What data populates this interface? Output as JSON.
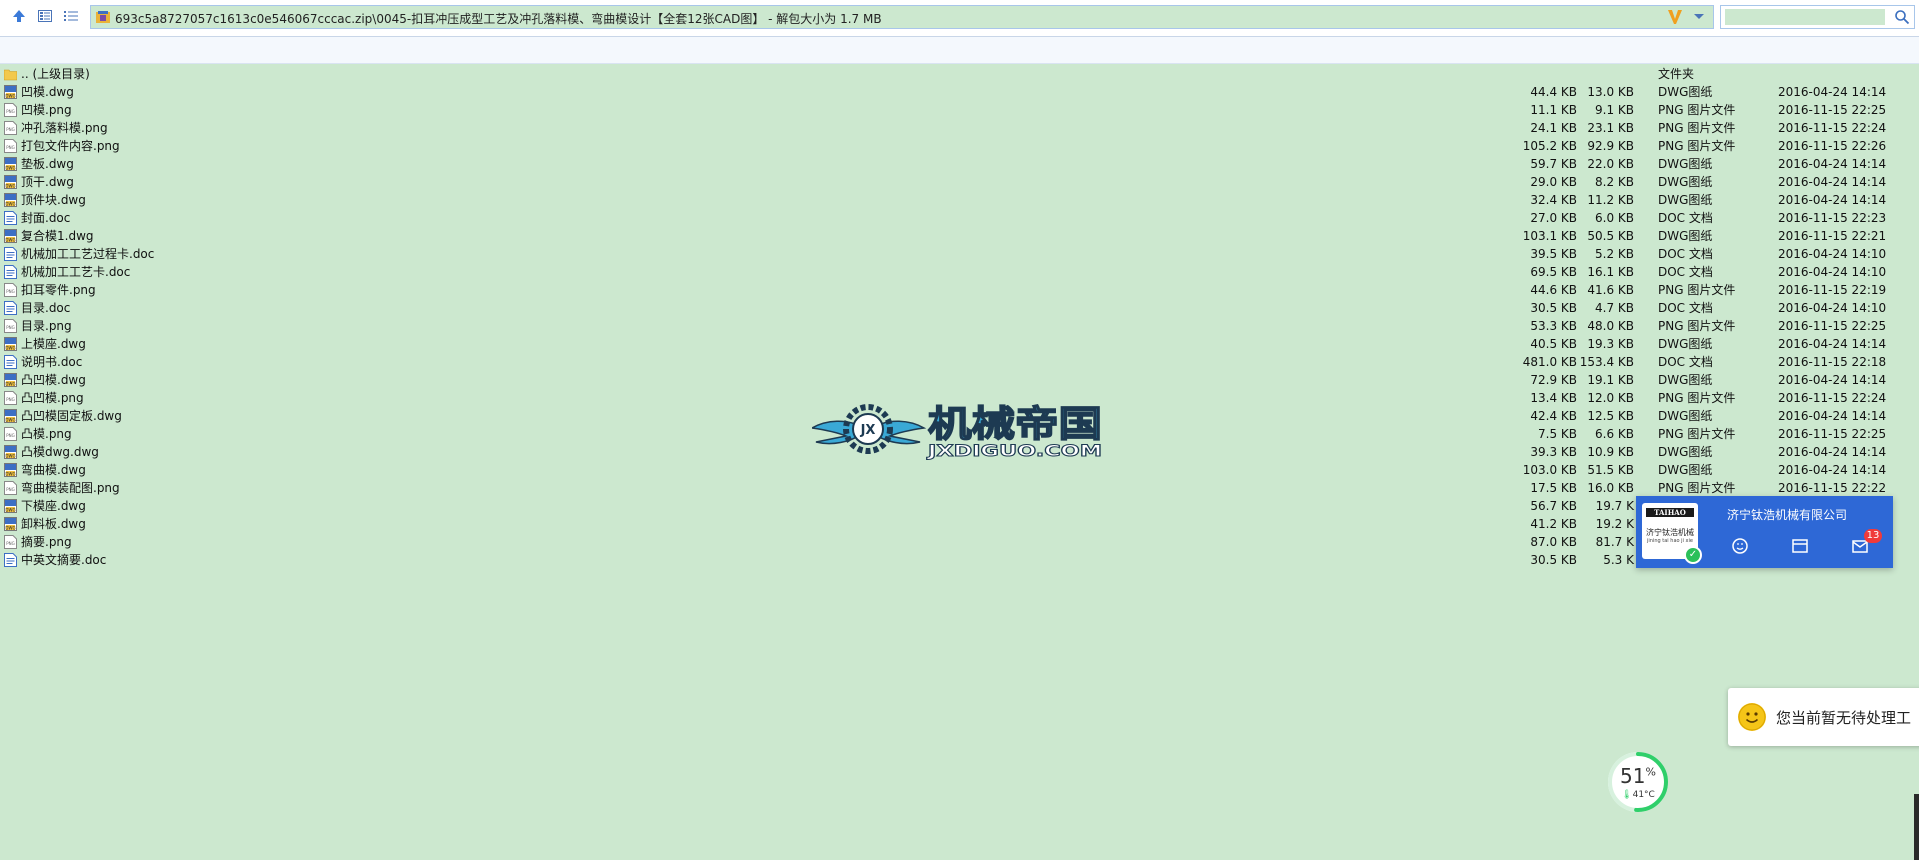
{
  "toolbar": {
    "address_text": "693c5a8727057c1613c0e546067cccac.zip\\0045-扣耳冲压成型工艺及冲孔落料模、弯曲模设计【全套12张CAD图】 - 解包大小为 1.7 MB",
    "search_placeholder": ""
  },
  "files": [
    {
      "name": ".. (上级目录)",
      "size": "",
      "packed": "",
      "type": "文件夹",
      "date": "",
      "icon": "folder-icon"
    },
    {
      "name": "凹模.dwg",
      "size": "44.4 KB",
      "packed": "13.0 KB",
      "type": "DWG图纸",
      "date": "2016-04-24 14:14",
      "icon": "dwg-file-icon"
    },
    {
      "name": "凹模.png",
      "size": "11.1 KB",
      "packed": "9.1 KB",
      "type": "PNG 图片文件",
      "date": "2016-11-15 22:25",
      "icon": "png-file-icon"
    },
    {
      "name": "冲孔落料模.png",
      "size": "24.1 KB",
      "packed": "23.1 KB",
      "type": "PNG 图片文件",
      "date": "2016-11-15 22:24",
      "icon": "png-file-icon"
    },
    {
      "name": "打包文件内容.png",
      "size": "105.2 KB",
      "packed": "92.9 KB",
      "type": "PNG 图片文件",
      "date": "2016-11-15 22:26",
      "icon": "png-file-icon"
    },
    {
      "name": "垫板.dwg",
      "size": "59.7 KB",
      "packed": "22.0 KB",
      "type": "DWG图纸",
      "date": "2016-04-24 14:14",
      "icon": "dwg-file-icon"
    },
    {
      "name": "顶干.dwg",
      "size": "29.0 KB",
      "packed": "8.2 KB",
      "type": "DWG图纸",
      "date": "2016-04-24 14:14",
      "icon": "dwg-file-icon"
    },
    {
      "name": "顶件块.dwg",
      "size": "32.4 KB",
      "packed": "11.2 KB",
      "type": "DWG图纸",
      "date": "2016-04-24 14:14",
      "icon": "dwg-file-icon"
    },
    {
      "name": "封面.doc",
      "size": "27.0 KB",
      "packed": "6.0 KB",
      "type": "DOC 文档",
      "date": "2016-11-15 22:23",
      "icon": "doc-file-icon"
    },
    {
      "name": "复合模1.dwg",
      "size": "103.1 KB",
      "packed": "50.5 KB",
      "type": "DWG图纸",
      "date": "2016-11-15 22:21",
      "icon": "dwg-file-icon"
    },
    {
      "name": "机械加工工艺过程卡.doc",
      "size": "39.5 KB",
      "packed": "5.2 KB",
      "type": "DOC 文档",
      "date": "2016-04-24 14:10",
      "icon": "doc-file-icon"
    },
    {
      "name": "机械加工工艺卡.doc",
      "size": "69.5 KB",
      "packed": "16.1 KB",
      "type": "DOC 文档",
      "date": "2016-04-24 14:10",
      "icon": "doc-file-icon"
    },
    {
      "name": "扣耳零件.png",
      "size": "44.6 KB",
      "packed": "41.6 KB",
      "type": "PNG 图片文件",
      "date": "2016-11-15 22:19",
      "icon": "png-file-icon"
    },
    {
      "name": "目录.doc",
      "size": "30.5 KB",
      "packed": "4.7 KB",
      "type": "DOC 文档",
      "date": "2016-04-24 14:10",
      "icon": "doc-file-icon"
    },
    {
      "name": "目录.png",
      "size": "53.3 KB",
      "packed": "48.0 KB",
      "type": "PNG 图片文件",
      "date": "2016-11-15 22:25",
      "icon": "png-file-icon"
    },
    {
      "name": "上模座.dwg",
      "size": "40.5 KB",
      "packed": "19.3 KB",
      "type": "DWG图纸",
      "date": "2016-04-24 14:14",
      "icon": "dwg-file-icon"
    },
    {
      "name": "说明书.doc",
      "size": "481.0 KB",
      "packed": "153.4 KB",
      "type": "DOC 文档",
      "date": "2016-11-15 22:18",
      "icon": "doc-file-icon"
    },
    {
      "name": "凸凹模.dwg",
      "size": "72.9 KB",
      "packed": "19.1 KB",
      "type": "DWG图纸",
      "date": "2016-04-24 14:14",
      "icon": "dwg-file-icon"
    },
    {
      "name": "凸凹模.png",
      "size": "13.4 KB",
      "packed": "12.0 KB",
      "type": "PNG 图片文件",
      "date": "2016-11-15 22:24",
      "icon": "png-file-icon"
    },
    {
      "name": "凸凹模固定板.dwg",
      "size": "42.4 KB",
      "packed": "12.5 KB",
      "type": "DWG图纸",
      "date": "2016-04-24 14:14",
      "icon": "dwg-file-icon"
    },
    {
      "name": "凸模.png",
      "size": "7.5 KB",
      "packed": "6.6 KB",
      "type": "PNG 图片文件",
      "date": "2016-11-15 22:25",
      "icon": "png-file-icon"
    },
    {
      "name": "凸模dwg.dwg",
      "size": "39.3 KB",
      "packed": "10.9 KB",
      "type": "DWG图纸",
      "date": "2016-04-24 14:14",
      "icon": "dwg-file-icon"
    },
    {
      "name": "弯曲模.dwg",
      "size": "103.0 KB",
      "packed": "51.5 KB",
      "type": "DWG图纸",
      "date": "2016-04-24 14:14",
      "icon": "dwg-file-icon"
    },
    {
      "name": "弯曲模装配图.png",
      "size": "17.5 KB",
      "packed": "16.0 KB",
      "type": "PNG 图片文件",
      "date": "2016-11-15 22:22",
      "icon": "png-file-icon"
    },
    {
      "name": "下模座.dwg",
      "size": "56.7 KB",
      "packed": "19.7 K",
      "type": "",
      "date": "",
      "icon": "dwg-file-icon"
    },
    {
      "name": "卸料板.dwg",
      "size": "41.2 KB",
      "packed": "19.2 K",
      "type": "",
      "date": "",
      "icon": "dwg-file-icon"
    },
    {
      "name": "摘要.png",
      "size": "87.0 KB",
      "packed": "81.7 K",
      "type": "",
      "date": "",
      "icon": "png-file-icon"
    },
    {
      "name": "中英文摘要.doc",
      "size": "30.5 KB",
      "packed": "5.3 K",
      "type": "",
      "date": "",
      "icon": "doc-file-icon"
    }
  ],
  "watermark": {
    "cn": "机械帝国",
    "en": "JXDIGUO.COM",
    "badge": "JX"
  },
  "popup": {
    "company": "济宁钛浩机械有限公司",
    "logo_brand": "TAIHAO",
    "logo_name": "济宁钛浩机械",
    "logo_sub": "jining tai hao ji xie",
    "badge_count": "13"
  },
  "notification": {
    "text": "您当前暂无待处理工"
  },
  "monitor": {
    "percent": "51",
    "percent_unit": "%",
    "temp": "41°C",
    "level": 0.51
  },
  "colors": {
    "background": "#cce8cf",
    "popup": "#2e68d6",
    "badge": "#f03a3a",
    "monitor_ring": "#2fcf6a",
    "watermark_blue": "#3aa9d6",
    "watermark_dark": "#1d3a52"
  }
}
